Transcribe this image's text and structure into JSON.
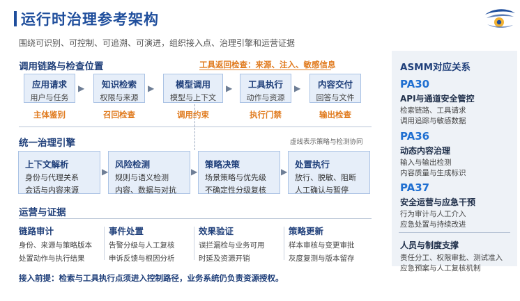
{
  "header": {
    "title": "运行时治理参考架构",
    "subtitle": "围绕可识别、可控制、可追溯、可演进，组织接入点、治理引擎和运营证据"
  },
  "chain": {
    "title": "调用链路与检查位置",
    "tool_note": "工具返回检查：来源、注入、敏感信息",
    "boxes": [
      {
        "title": "应用请求",
        "sub": "用户与任务"
      },
      {
        "title": "知识检索",
        "sub": "权限与来源"
      },
      {
        "title": "模型调用",
        "sub": "模型与上下文"
      },
      {
        "title": "工具执行",
        "sub": "动作与资源"
      },
      {
        "title": "内容交付",
        "sub": "回答与文件"
      }
    ],
    "checks": [
      "主体鉴别",
      "召回检查",
      "调用约束",
      "执行门禁",
      "输出检查"
    ]
  },
  "engine": {
    "title": "统一治理引擎",
    "hint": "虚线表示策略与检测协同",
    "boxes": [
      {
        "title": "上下文解析",
        "l1": "身份与代理关系",
        "l2": "会话与内容来源"
      },
      {
        "title": "风险检测",
        "l1": "规则与语义检测",
        "l2": "内容、数据与对抗"
      },
      {
        "title": "策略决策",
        "l1": "场景策略与优先级",
        "l2": "不确定性分级复核"
      },
      {
        "title": "处置执行",
        "l1": "放行、脱敏、阻断",
        "l2": "人工确认与暂停"
      }
    ]
  },
  "ops": {
    "title": "运营与证据",
    "cols": [
      {
        "title": "链路审计",
        "l1": "身份、来源与策略版本",
        "l2": "处置动作与执行结果"
      },
      {
        "title": "事件处置",
        "l1": "告警分级与人工复核",
        "l2": "申诉反馈与根因分析"
      },
      {
        "title": "效果验证",
        "l1": "误拦漏检与业务可用",
        "l2": "时延及资源开销"
      },
      {
        "title": "策略更新",
        "l1": "样本审核与变更审批",
        "l2": "灰度复测与版本留存"
      }
    ],
    "footer": "接入前提：检索与工具执行点须进入控制路径，业务系统仍负责资源授权。"
  },
  "asmm": {
    "title": "ASMM对应关系",
    "items": [
      {
        "code": "PA30",
        "name": "API与通道安全管控",
        "l1": "检索链路、工具请求",
        "l2": "调用追踪与敏感数据"
      },
      {
        "code": "PA36",
        "name": "动态内容治理",
        "l1": "输入与输出检测",
        "l2": "内容质量与生成标识"
      },
      {
        "code": "PA37",
        "name": "安全运营与应急干预",
        "l1": "行为审计与人工介入",
        "l2": "应急处置与持续改进"
      }
    ],
    "people": {
      "name": "人员与制度支撑",
      "l1": "责任分工、权限审批、测试准入",
      "l2": "应急预案与人工复核机制"
    }
  },
  "colors": {
    "primary": "#1f4e9c",
    "accent": "#e07b1f",
    "box_fill": "#e6eef9",
    "panel_fill": "#eef2f7",
    "code": "#1f6fd1"
  },
  "icons": {
    "logo": "brand-logo-icon",
    "arrow": "arrow-right-icon"
  }
}
